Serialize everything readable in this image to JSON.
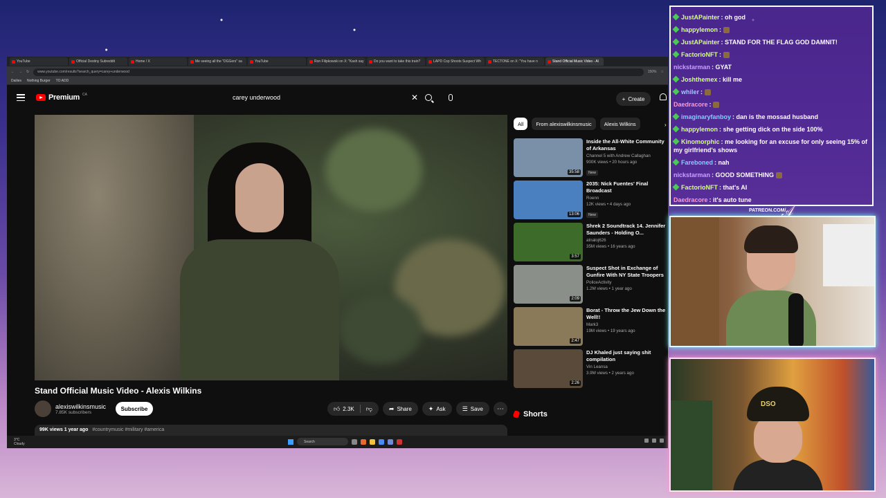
{
  "browser": {
    "tabs": [
      "YouTube",
      "Official Destiny Subreddit",
      "Home / X",
      "Me seeing all the \"DGGers\" sa",
      "YouTube",
      "Ron Filipkowski on X: \"Kash say",
      "Do you want to take this train?",
      "LAPD Cop Shoots Suspect Wh",
      "TECTONE on X: \"You have n",
      "Stand Official Music Video - Al"
    ],
    "url": "www.youtube.com/results?search_query=carey+underwood",
    "zoom": "150%",
    "bookmarks": [
      "Dailies",
      "Nothing Burger",
      "TO ADD"
    ]
  },
  "youtube": {
    "logo": "Premium",
    "region": "CA",
    "search_value": "carey underwood",
    "create_label": "Create",
    "video_title": "Stand Official Music Video - Alexis Wilkins",
    "channel_name": "alexiswilkinsmusic",
    "subscribers": "7.85K subscribers",
    "subscribe_label": "Subscribe",
    "likes": "2.3K",
    "share_label": "Share",
    "ask_label": "Ask",
    "save_label": "Save",
    "description_meta": "99K views  1 year ago",
    "description_tags": "#countrymusic #military #america",
    "chips": [
      "All",
      "From alexiswilkinsmusic",
      "Alexis Wilkins"
    ],
    "shorts_label": "Shorts",
    "recommendations": [
      {
        "title": "Inside the All-White Community of Arkansas",
        "channel": "Channel 5 with Andrew Callaghan",
        "meta": "900K views • 20 hours ago",
        "badge": "New",
        "duration": "35:58",
        "color": "#7a8fa8"
      },
      {
        "title": "2035: Nick Fuentes' Final Broadcast",
        "channel": "Roenn",
        "meta": "12K views • 4 days ago",
        "badge": "New",
        "duration": "13:06",
        "color": "#4a7fc0"
      },
      {
        "title": "Shrek 2 Soundtrack  14. Jennifer Saunders - Holding O...",
        "channel": "atnaloj626",
        "meta": "35M views • 16 years ago",
        "badge": "",
        "duration": "3:57",
        "color": "#3d6b2a"
      },
      {
        "title": "Suspect Shot in Exchange of Gunfire With NY State Troopers",
        "channel": "PoliceActivity",
        "meta": "1.2M views • 1 year ago",
        "badge": "",
        "duration": "2:09",
        "color": "#8a8f8a"
      },
      {
        "title": "Borat - Throw the Jew Down the Well!!",
        "channel": "Mark3",
        "meta": "19M views • 19 years ago",
        "badge": "",
        "duration": "2:47",
        "color": "#8a7a5a"
      },
      {
        "title": "DJ Khaled just saying shit compilation",
        "channel": "Vin Leansa",
        "meta": "3.9M views • 2 years ago",
        "badge": "",
        "duration": "2:26",
        "color": "#5a4a3a"
      }
    ]
  },
  "taskbar": {
    "weather_temp": "3°C",
    "weather_cond": "Cloudy",
    "search_placeholder": "Search"
  },
  "chat": {
    "messages": [
      {
        "user": "JustAPainter",
        "text": "oh god",
        "color": "#d4ff8a",
        "badge": true
      },
      {
        "user": "happylemon",
        "text": "",
        "color": "#d4ff8a",
        "badge": true,
        "emote": true
      },
      {
        "user": "JustAPainter",
        "text": "STAND FOR THE FLAG GOD DAMNIT!",
        "color": "#d4ff8a",
        "badge": true
      },
      {
        "user": "FactorioNFT",
        "text": "",
        "color": "#d4ff8a",
        "badge": true,
        "emote": true
      },
      {
        "user": "nickstarman",
        "text": "GYAT",
        "color": "#c9a0ff",
        "badge": false
      },
      {
        "user": "Joshthemex",
        "text": "kill me",
        "color": "#d4ff8a",
        "badge": true
      },
      {
        "user": "whiler",
        "text": "",
        "color": "#a0c8ff",
        "badge": true,
        "emote": true
      },
      {
        "user": "Daedracore",
        "text": "",
        "color": "#ff9ad0",
        "badge": false,
        "emote": true
      },
      {
        "user": "imaginaryfanboy",
        "text": "dan is the mossad husband",
        "color": "#7fd0ff",
        "badge": true
      },
      {
        "user": "happylemon",
        "text": "she getting dick on the side 100%",
        "color": "#d4ff8a",
        "badge": true
      },
      {
        "user": "Kinomorphic",
        "text": "me looking for an excuse for only seeing 15% of my girlfriend's shows",
        "color": "#d4ff8a",
        "badge": true,
        "wrap": true
      },
      {
        "user": "Fareboned",
        "text": "nah",
        "color": "#7fd0ff",
        "badge": true
      },
      {
        "user": "nickstarman",
        "text": "GOOD SOMETHING",
        "color": "#c9a0ff",
        "badge": false,
        "emote": true
      },
      {
        "user": "FactorioNFT",
        "text": "that's AI",
        "color": "#d4ff8a",
        "badge": true
      },
      {
        "user": "Daedracore",
        "text": "it's auto tune",
        "color": "#ff9ad0",
        "badge": false
      }
    ]
  },
  "overlay": {
    "patreon": "PATREON.COM/",
    "signature": "Anthony Babe",
    "cap_text": "DSO"
  }
}
